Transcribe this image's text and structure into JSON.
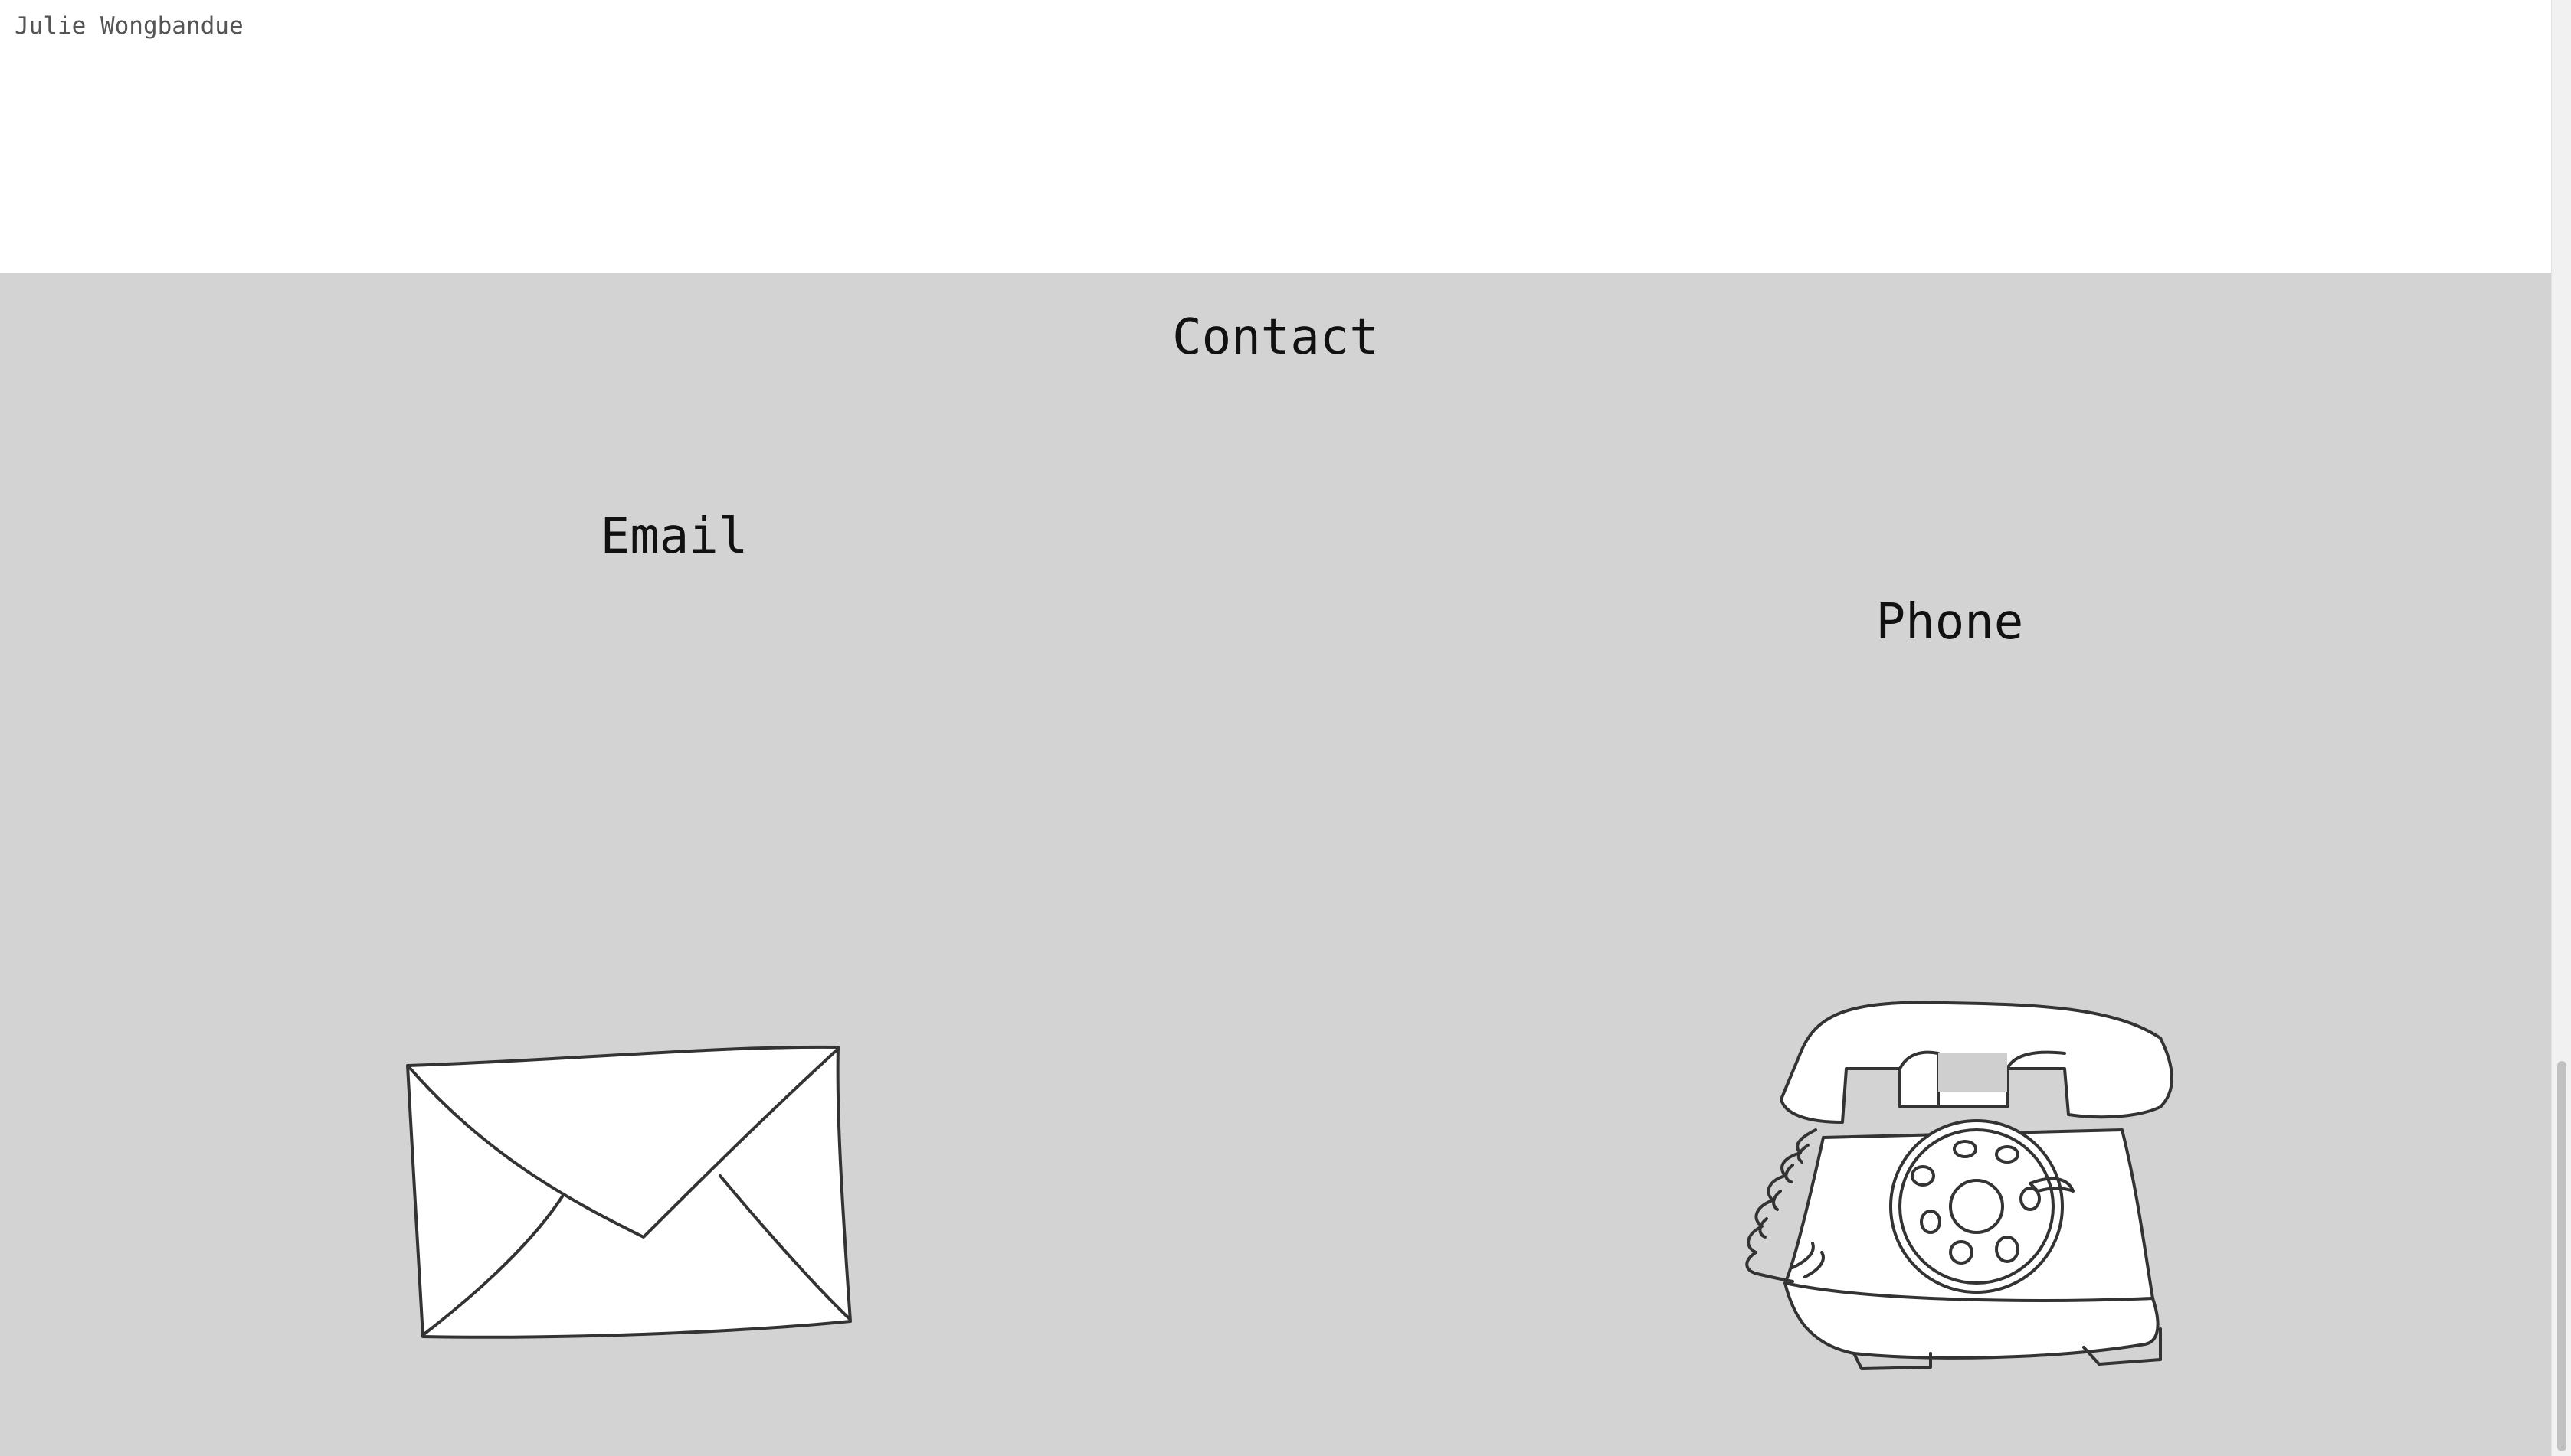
{
  "header": {
    "author_name": "Julie Wongbandue"
  },
  "contact": {
    "title": "Contact",
    "email": {
      "label": "Email",
      "icon": "envelope-icon"
    },
    "phone": {
      "label": "Phone",
      "icon": "rotary-phone-icon"
    }
  },
  "colors": {
    "section_background": "#d3d3d3",
    "page_background": "#ffffff",
    "ink": "#333333"
  }
}
